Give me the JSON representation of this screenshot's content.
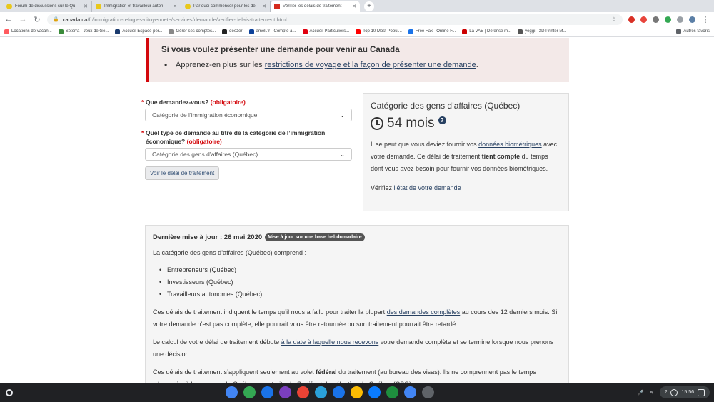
{
  "browser": {
    "tabs": [
      {
        "title": "Forum de discussions sur le Qu",
        "active": false
      },
      {
        "title": "Immigration et travailleur auton",
        "active": false
      },
      {
        "title": "Par quoi commencer pour les dé",
        "active": false
      },
      {
        "title": "Vérifier les délais de traitement",
        "active": true
      }
    ],
    "url_host": "canada.ca",
    "url_path": "/fr/immigration-refugies-citoyennete/services/demande/verifier-delais-traitement.html",
    "bookmarks": [
      {
        "label": "Locations de vacan...",
        "color": "#ff5a5f"
      },
      {
        "label": "Seterra - Jeux de Gé...",
        "color": "#3a8b3a"
      },
      {
        "label": "Accueil Espace per...",
        "color": "#1a3a6e"
      },
      {
        "label": "Gérer ses comptes...",
        "color": "#888888"
      },
      {
        "label": "deezer",
        "color": "#222222"
      },
      {
        "label": "ameli.fr - Compte a...",
        "color": "#0c419a"
      },
      {
        "label": "Accueil Particuliers...",
        "color": "#e1000f"
      },
      {
        "label": "Top 10 Most Popul...",
        "color": "#ff0000"
      },
      {
        "label": "Free Fax - Online F...",
        "color": "#1a73e8"
      },
      {
        "label": "La VAE | Défense m...",
        "color": "#cc0000"
      },
      {
        "label": "yeggi - 3D Printer M...",
        "color": "#555555"
      }
    ],
    "other_bookmarks": "Autres favoris"
  },
  "alert": {
    "title": "Si vous voulez présenter une demande pour venir au Canada",
    "item_prefix": "Apprenez-en plus sur les ",
    "item_link": "restrictions de voyage et la façon de présenter une demande",
    "item_suffix": "."
  },
  "form": {
    "q1_label": "Que demandez-vous?",
    "q1_required": "(obligatoire)",
    "q1_value": "Catégorie de l’immigration économique",
    "q2_label": "Quel type de demande au titre de la catégorie de l’immigration économique?",
    "q2_required": "(obligatoire)",
    "q2_value": "Catégorie des gens d’affaires (Québec)",
    "submit_label": "Voir le délai de traitement"
  },
  "result": {
    "title": "Catégorie des gens d’affaires (Québec)",
    "duration": "54 mois",
    "help_symbol": "?",
    "p1_a": "Il se peut que vous deviez fournir vos ",
    "p1_link": "données biométriques",
    "p1_b": " avec votre demande. Ce délai de traitement ",
    "p1_bold": "tient compte",
    "p1_c": " du temps dont vous avez besoin pour fournir vos données biométriques.",
    "p2_a": "Vérifiez ",
    "p2_link": "l’état de votre demande"
  },
  "details": {
    "updated_label": "Dernière mise à jour : 26 mai 2020",
    "badge": "Mise à jour sur une base hebdomadaire",
    "intro": "La catégorie des gens d’affaires (Québec) comprend :",
    "items": [
      "Entrepreneurs (Québec)",
      "Investisseurs (Québec)",
      "Travailleurs autonomes (Québec)"
    ],
    "p1_a": "Ces délais de traitement indiquent le temps qu’il nous a fallu pour traiter la plupart ",
    "p1_link": "des demandes complètes",
    "p1_b": " au cours des 12 derniers mois. Si votre demande n’est pas complète, elle pourrait vous être retournée ou son traitement pourrait être retardé.",
    "p2_a": "Le calcul de votre délai de traitement débute ",
    "p2_link": "à la date à laquelle nous recevons",
    "p2_b": " votre demande complète et se termine lorsque nous prenons une décision.",
    "p3_a": "Ces délais de traitement s’appliquent seulement au volet ",
    "p3_bold": "fédéral",
    "p3_b": " du traitement (au bureau des visas). Ils ne comprennent pas le temps nécessaire à la province de Québec pour traiter le Certificat de sélection du Québec (CSQ)."
  },
  "shelf": {
    "apps": [
      {
        "name": "chrome-icon",
        "color": "#4285f4"
      },
      {
        "name": "play-store-icon",
        "color": "#34a853"
      },
      {
        "name": "files-icon",
        "color": "#1a73e8"
      },
      {
        "name": "app-icon",
        "color": "#7b3fbf"
      },
      {
        "name": "gmail-icon",
        "color": "#ea4335"
      },
      {
        "name": "telegram-icon",
        "color": "#2aa1da"
      },
      {
        "name": "files-folder-icon",
        "color": "#1a73e8"
      },
      {
        "name": "drive-icon",
        "color": "#fbbc04"
      },
      {
        "name": "messenger-icon",
        "color": "#0a7cff"
      },
      {
        "name": "camera-icon",
        "color": "#1e8e3e"
      },
      {
        "name": "calendar-icon",
        "color": "#4285f4"
      },
      {
        "name": "settings-app-icon",
        "color": "#5f6368"
      }
    ],
    "notifications": "2",
    "clock": "15:56"
  }
}
